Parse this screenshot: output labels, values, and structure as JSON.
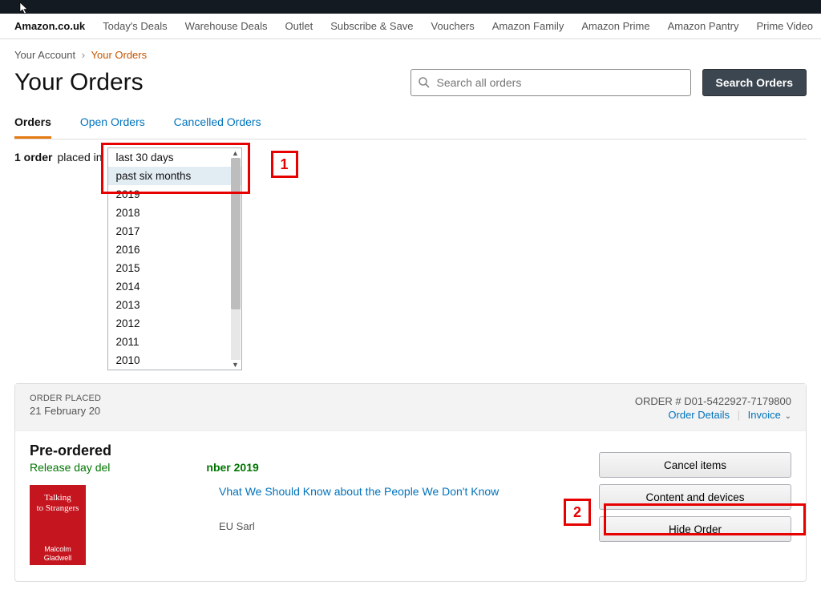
{
  "nav": {
    "brand": "Amazon.co.uk",
    "items": [
      "Today's Deals",
      "Warehouse Deals",
      "Outlet",
      "Subscribe & Save",
      "Vouchers",
      "Amazon Family",
      "Amazon Prime",
      "Amazon Pantry",
      "Prime Video"
    ]
  },
  "breadcrumb": {
    "account": "Your Account",
    "current": "Your Orders"
  },
  "title": "Your Orders",
  "search": {
    "placeholder": "Search all orders",
    "button": "Search Orders"
  },
  "tabs": {
    "orders": "Orders",
    "open": "Open Orders",
    "cancelled": "Cancelled Orders"
  },
  "filter": {
    "count": "1 order",
    "placed_in": "placed in",
    "options": [
      "last 30 days",
      "past six months",
      "2019",
      "2018",
      "2017",
      "2016",
      "2015",
      "2014",
      "2013",
      "2012",
      "2011",
      "2010"
    ],
    "selected": "past six months"
  },
  "order": {
    "placed_label": "ORDER PLACED",
    "placed_date": "21 February 20",
    "order_num_label": "ORDER # D01-5422927-7179800",
    "order_details": "Order Details",
    "invoice": "Invoice",
    "preordered": "Pre-ordered",
    "release_1": "Release day del",
    "release_2": "nber 2019",
    "item_title_suffix": "Vhat We Should Know about the People We Don't Know",
    "seller_suffix": "EU Sarl",
    "actions": {
      "cancel": "Cancel items",
      "content": "Content and devices",
      "hide": "Hide Order"
    },
    "thumb": {
      "line1": "Talking",
      "line2": "to Strangers",
      "author": "Malcolm Gladwell"
    }
  },
  "annotations": {
    "a1": "1",
    "a2": "2"
  }
}
